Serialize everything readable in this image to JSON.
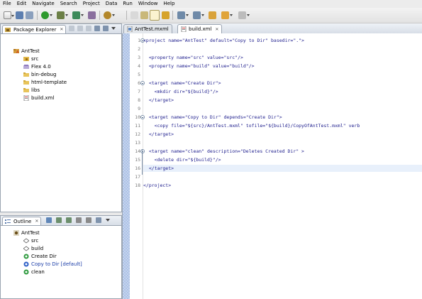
{
  "menu": [
    "File",
    "Edit",
    "Navigate",
    "Search",
    "Project",
    "Data",
    "Run",
    "Window",
    "Help"
  ],
  "package_explorer": {
    "tab_label": "Package Explorer",
    "close_glyph": "✕",
    "tree": [
      {
        "label": "AntTest",
        "icon": "project-icon"
      },
      {
        "label": "src",
        "icon": "source-folder-icon"
      },
      {
        "label": "Flex 4.0",
        "icon": "library-icon"
      },
      {
        "label": "bin-debug",
        "icon": "folder-icon"
      },
      {
        "label": "html-template",
        "icon": "folder-icon"
      },
      {
        "label": "libs",
        "icon": "folder-icon"
      },
      {
        "label": "build.xml",
        "icon": "xml-file-icon"
      }
    ]
  },
  "outline": {
    "tab_label": "Outline",
    "close_glyph": "✕",
    "tree": [
      {
        "label": "AntTest",
        "icon": "ant-project-icon"
      },
      {
        "label": "src",
        "icon": "property-icon"
      },
      {
        "label": "build",
        "icon": "property-icon"
      },
      {
        "label": "Create Dir",
        "icon": "target-icon"
      },
      {
        "label": "Copy to Dir [default]",
        "icon": "default-target-icon"
      },
      {
        "label": "clean",
        "icon": "target-icon"
      }
    ]
  },
  "editor": {
    "tabs": [
      {
        "label": "AntTest.mxml",
        "active": false
      },
      {
        "label": "build.xml",
        "active": true
      }
    ],
    "close_glyph": "✕",
    "line_numbers": [
      "1",
      "2",
      "3",
      "4",
      "5",
      "6",
      "7",
      "8",
      "9",
      "10",
      "11",
      "12",
      "13",
      "14",
      "15",
      "16",
      "17",
      "18"
    ],
    "lines": [
      "<project name=\"AntTest\" default=\"Copy to Dir\" basedir=\".\">",
      "",
      "  <property name=\"src\" value=\"src\"/>",
      "  <property name=\"build\" value=\"build\"/>",
      "",
      "  <target name=\"Create Dir\">",
      "    <mkdir dir=\"${build}\"/>",
      "  </target>",
      "",
      "  <target name=\"Copy to Dir\" depends=\"Create Dir\">",
      "    <copy file=\"${src}/AntTest.mxml\" tofile=\"${build}/CopyOfAntTest.mxml\" verb",
      "  </target>",
      "",
      "  <target name=\"clean\" description=\"Deletes Created Dir\" >",
      "    <delete dir=\"${build}\"/>",
      "  </target>",
      "",
      "</project>"
    ]
  },
  "colors": {
    "code_blue": "#1c1c8c",
    "line_number_gray": "#7a7a7a",
    "current_line_bg": "#e8f0fb"
  }
}
